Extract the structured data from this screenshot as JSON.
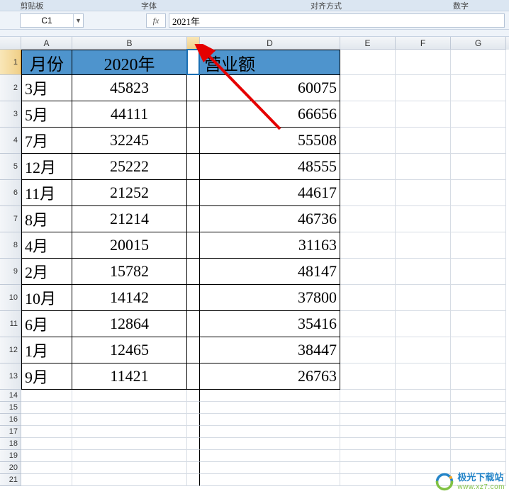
{
  "ribbon": {
    "group1": "剪贴板",
    "group2": "字体",
    "group3": "对齐方式",
    "group4": "数字"
  },
  "namebox": {
    "ref": "C1"
  },
  "formula_bar": {
    "fx_label": "fx",
    "value": "2021年"
  },
  "columns": [
    "A",
    "B",
    "C",
    "D",
    "E",
    "F",
    "G"
  ],
  "header": {
    "month": "月份",
    "y2020": "2020年",
    "sales": "营业额"
  },
  "rows": [
    {
      "month": "3月",
      "y2020": "45823",
      "sales": "60075"
    },
    {
      "month": "5月",
      "y2020": "44111",
      "sales": "66656"
    },
    {
      "month": "7月",
      "y2020": "32245",
      "sales": "55508"
    },
    {
      "month": "12月",
      "y2020": "25222",
      "sales": "48555"
    },
    {
      "month": "11月",
      "y2020": "21252",
      "sales": "44617"
    },
    {
      "month": "8月",
      "y2020": "21214",
      "sales": "46736"
    },
    {
      "month": "4月",
      "y2020": "20015",
      "sales": "31163"
    },
    {
      "month": "2月",
      "y2020": "15782",
      "sales": "48147"
    },
    {
      "month": "10月",
      "y2020": "14142",
      "sales": "37800"
    },
    {
      "month": "6月",
      "y2020": "12864",
      "sales": "35416"
    },
    {
      "month": "1月",
      "y2020": "12465",
      "sales": "38447"
    },
    {
      "month": "9月",
      "y2020": "11421",
      "sales": "26763"
    }
  ],
  "row_numbers": [
    "1",
    "2",
    "3",
    "4",
    "5",
    "6",
    "7",
    "8",
    "9",
    "10",
    "11",
    "12",
    "13",
    "14",
    "15",
    "16",
    "17",
    "18",
    "19",
    "20",
    "21"
  ],
  "watermark": {
    "cn": "极光下载站",
    "en": "www.xz7.com"
  },
  "selected_cell": "C1"
}
